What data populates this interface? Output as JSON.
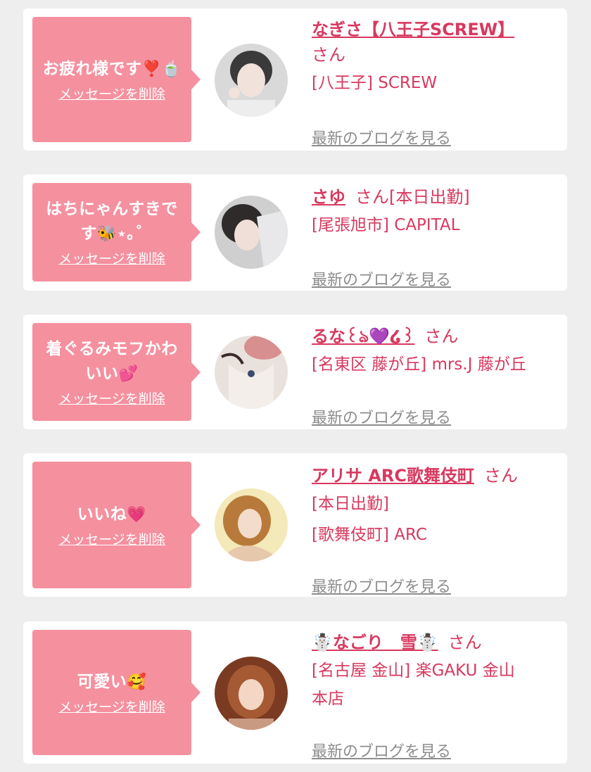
{
  "colors": {
    "background": "#eeeeee",
    "card": "#ffffff",
    "bubble": "#f5909f",
    "accent": "#d8395f",
    "muted": "#8d8d8d"
  },
  "entries": [
    {
      "message": "お疲れ様です",
      "message_emoji": "❣️🍵",
      "delete_label": "メッセージを削除",
      "name": "なぎさ【八王子SCREW】",
      "honorific": "さん",
      "lines": [
        "[八王子] SCREW"
      ],
      "blog_label": "最新のブログを見る"
    },
    {
      "message": "はちにゃんすきです",
      "message_emoji": "🐝⋆｡˚",
      "delete_label": "メッセージを削除",
      "name": "さゆ",
      "honorific": "さん[本日出勤]",
      "lines": [
        "[尾張旭市] CAPITAL"
      ],
      "blog_label": "最新のブログを見る"
    },
    {
      "message": "着ぐるみモフかわいい",
      "message_emoji": "💕",
      "delete_label": "メッセージを削除",
      "name": "るな꒰ঌ💜໒꒱",
      "honorific": "さん",
      "lines": [
        "[名東区 藤が丘] mrs.J 藤が丘"
      ],
      "blog_label": "最新のブログを見る"
    },
    {
      "message": "いいね",
      "message_emoji": "💗",
      "delete_label": "メッセージを削除",
      "name": "アリサ ARC歌舞伎町",
      "honorific": "さん",
      "lines": [
        "[本日出勤]",
        "[歌舞伎町] ARC"
      ],
      "blog_label": "最新のブログを見る"
    },
    {
      "message": "可愛い",
      "message_emoji": "🥰",
      "delete_label": "メッセージを削除",
      "name": "☃️なごり　雪☃️",
      "honorific": "さん",
      "lines": [
        "[名古屋 金山] 楽GAKU 金山",
        "本店"
      ],
      "blog_label": "最新のブログを見る"
    }
  ]
}
